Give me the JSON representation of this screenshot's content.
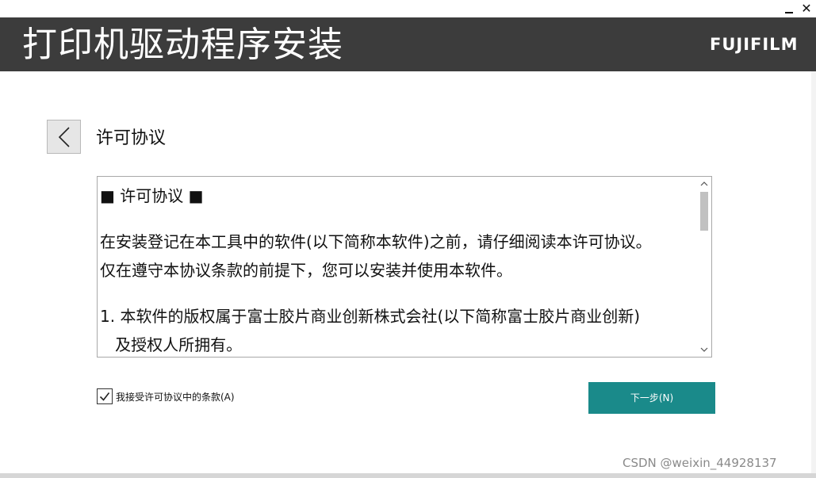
{
  "window": {
    "minimize_icon": "minimize-icon",
    "close_label": "✕"
  },
  "header": {
    "title": "打印机驱动程序安装",
    "logo": "FUJIFILM",
    "background": "#3c3c3c"
  },
  "page": {
    "back_icon": "chevron-left-icon",
    "section_title": "许可协议"
  },
  "license": {
    "lines": [
      "■ 许可协议 ■",
      "在安装登记在本工具中的软件(以下简称本软件)之前，请仔细阅读本许可协议。",
      "仅在遵守本协议条款的前提下，您可以安装并使用本软件。",
      "1. 本软件的版权属于富士胶片商业创新株式会社(以下简称富士胶片商业创新)",
      "   及授权人所拥有。"
    ],
    "scroll_up_icon": "scroll-up-icon",
    "scroll_down_icon": "scroll-down-icon"
  },
  "accept": {
    "checked": true,
    "label": "我接受许可协议中的条款(A)"
  },
  "actions": {
    "next_label": "下一步(N)",
    "accent": "#1a8a8a"
  },
  "watermark": "CSDN @weixin_44928137"
}
